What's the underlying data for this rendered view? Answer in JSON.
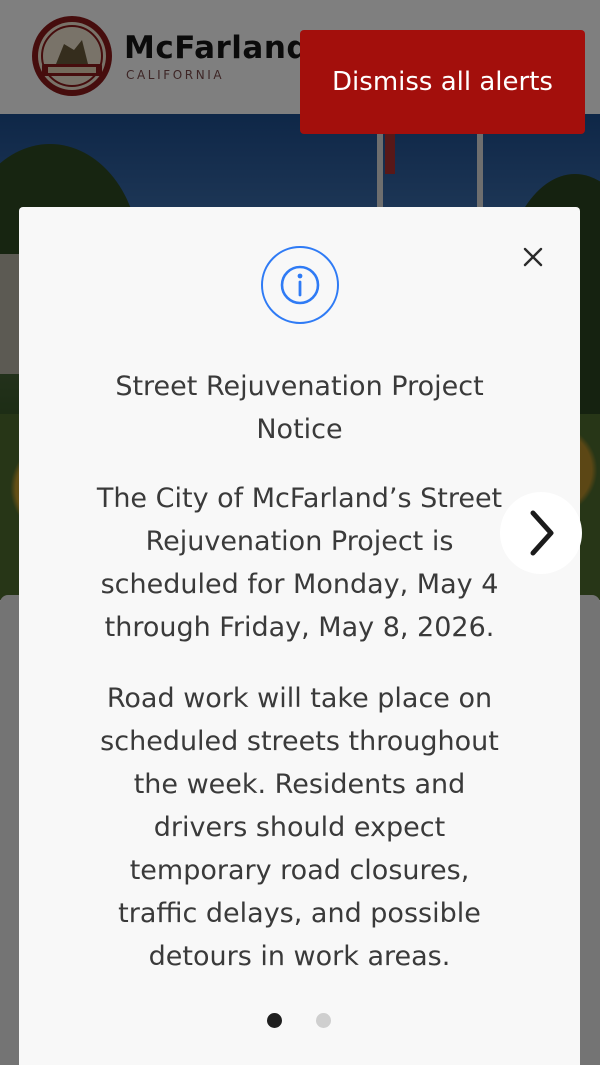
{
  "header": {
    "brand_name": "McFarland",
    "brand_sub": "CALIFORNIA",
    "logo_icon": "city-seal-icon"
  },
  "colors": {
    "dismiss_bg": "#a30f0c",
    "info_blue": "#2f7bf5",
    "overlay": "rgba(0,0,0,0.5)"
  },
  "alerts": {
    "dismiss_all_label": "Dismiss all alerts",
    "close_icon": "close-icon",
    "info_icon": "info-circle-icon",
    "prev_icon": "chevron-left-icon",
    "next_icon": "chevron-right-icon",
    "current": {
      "title": "Street Rejuvenation Project Notice",
      "paragraphs": [
        "The City of McFarland’s Street Rejuvenation Project is scheduled for Monday, May 4 through Friday, May 8, 2026.",
        "Road work will take place on scheduled streets throughout the week. Residents and drivers should expect temporary road closures, traffic delays, and possible detours in work areas."
      ]
    },
    "pagination": {
      "total": 2,
      "active_index": 0
    }
  }
}
